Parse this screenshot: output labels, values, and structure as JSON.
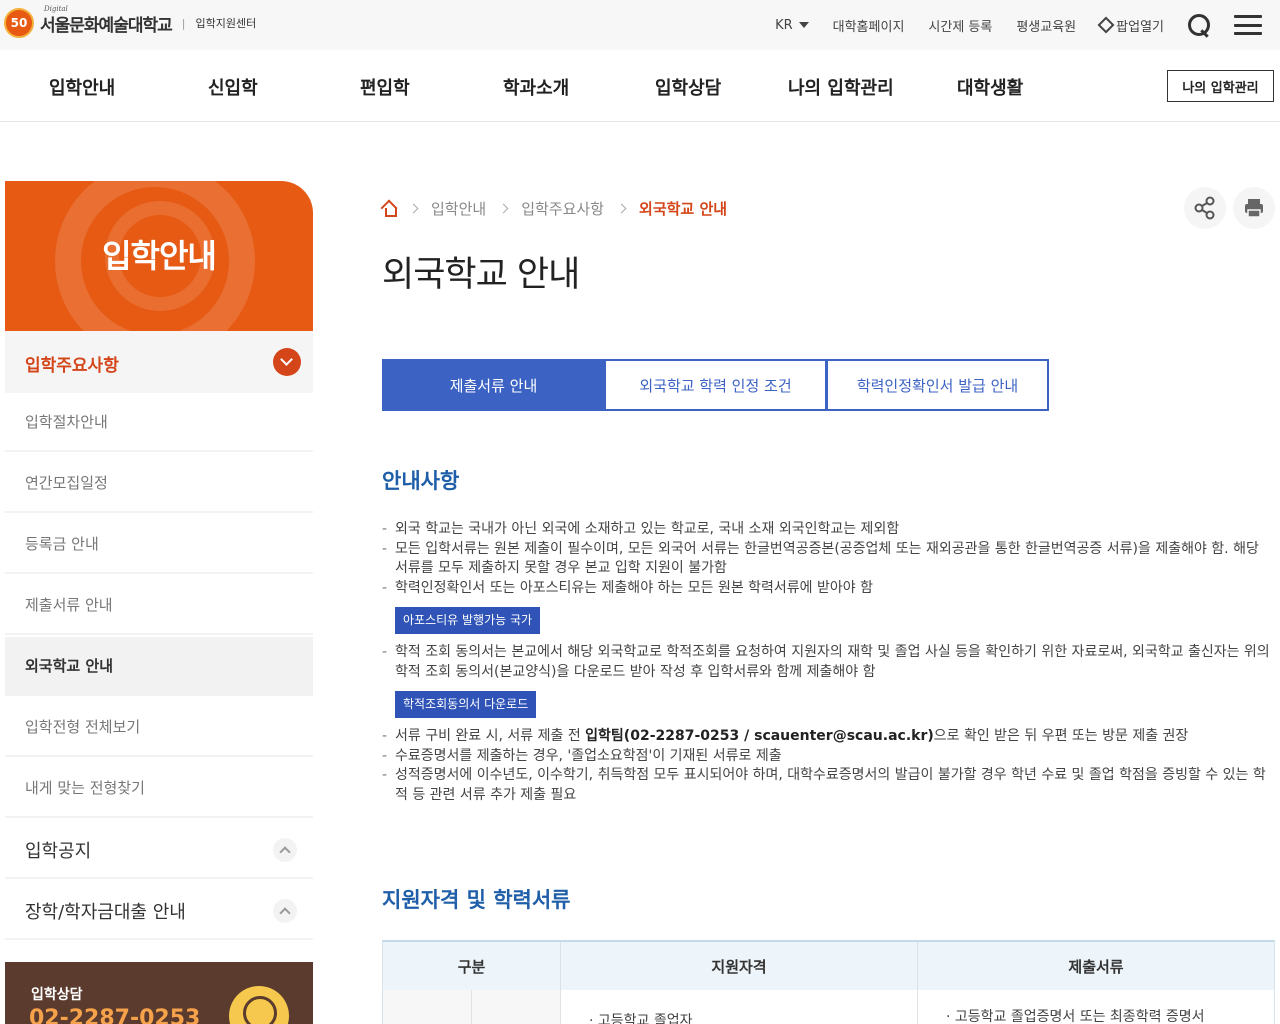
{
  "header": {
    "logo_badge": "50",
    "logo_sub": "Digital",
    "logo_name": "서울문화예술대학교",
    "logo_center": "입학지원센터",
    "util": {
      "lang": "KR",
      "univ_home": "대학홈페이지",
      "time_register": "시간제 등록",
      "lifelong": "평생교육원",
      "popup": "팝업열기"
    }
  },
  "gnb": {
    "items": [
      "입학안내",
      "신입학",
      "편입학",
      "학과소개",
      "입학상담",
      "나의 입학관리",
      "대학생활"
    ],
    "my_admin_button": "나의 입학관리"
  },
  "sidebar": {
    "hero_title": "입학안내",
    "active_section": "입학주요사항",
    "sub_items": [
      "입학절차안내",
      "연간모집일정",
      "등록금 안내",
      "제출서류 안내",
      "외국학교 안내",
      "입학전형 전체보기",
      "내게 맞는 전형찾기"
    ],
    "current_index": 4,
    "main_items": [
      "입학공지",
      "장학/학자금대출 안내"
    ],
    "consult_title": "입학상담",
    "consult_number": "02-2287-0253"
  },
  "breadcrumb": {
    "items": [
      "입학안내",
      "입학주요사항"
    ],
    "current": "외국학교 안내"
  },
  "page_title": "외국학교 안내",
  "tabs": [
    "제출서류 안내",
    "외국학교 학력 인정 조건",
    "학력인정확인서 발급 안내"
  ],
  "notice": {
    "title": "안내사항",
    "items": [
      "외국 학교는 국내가 아닌 외국에 소재하고 있는 학교로, 국내 소재 외국인학교는 제외함",
      "모든 입학서류는 원본 제출이 필수이며, 모든 외국어 서류는 한글번역공증본(공증업체 또는 재외공관을 통한 한글번역공증 서류)을 제출해야 함. 해당 서류를 모두 제출하지 못할 경우 본교 입학 지원이 불가함",
      "학력인정확인서 또는 아포스티유는 제출해야 하는 모든 원본 학력서류에 받아야 함"
    ],
    "apostille_button": "아포스티유 발행가능 국가",
    "item_consent": "학적 조회 동의서는 본교에서 해당 외국학교로 학적조회를 요청하여 지원자의 재학 및 졸업 사실 등을 확인하기 위한 자료로써, 외국학교 출신자는 위의 학적 조회 동의서(본교양식)을 다운로드 받아 작성 후 입학서류와 함께 제출해야 함",
    "consent_button": "학적조회동의서 다운로드",
    "item_submit_pre": "서류 구비 완료 시, 서류 제출 전 ",
    "item_submit_bold": "입학팀(02-2287-0253 / scauenter@scau.ac.kr)",
    "item_submit_post": "으로 확인 받은 뒤 우편 또는 방문 제출 권장",
    "item_complete": "수료증명서를 제출하는 경우, '졸업소요학점'이 기재된 서류로 제출",
    "item_grades": "성적증명서에 이수년도, 이수학기, 취득학점 모두 표시되어야 하며, 대학수료증명서의 발급이 불가할 경우 학년 수료 및 졸업 학점을 증빙할 수 있는 학적 등 관련 서류 추가 제출 필요"
  },
  "qualifications": {
    "title": "지원자격 및 학력서류",
    "headers": [
      "구분",
      "지원자격",
      "제출서류"
    ],
    "row1_qualification": "· 고등학교 졸업자",
    "row1_documents": "· 고등학교 졸업증명서 또는 최종학력 증명서"
  },
  "colors": {
    "accent": "#d4461a",
    "tab_blue": "#3c63c4",
    "section_title": "#1f5ea8",
    "hero_orange": "#e65a14"
  }
}
